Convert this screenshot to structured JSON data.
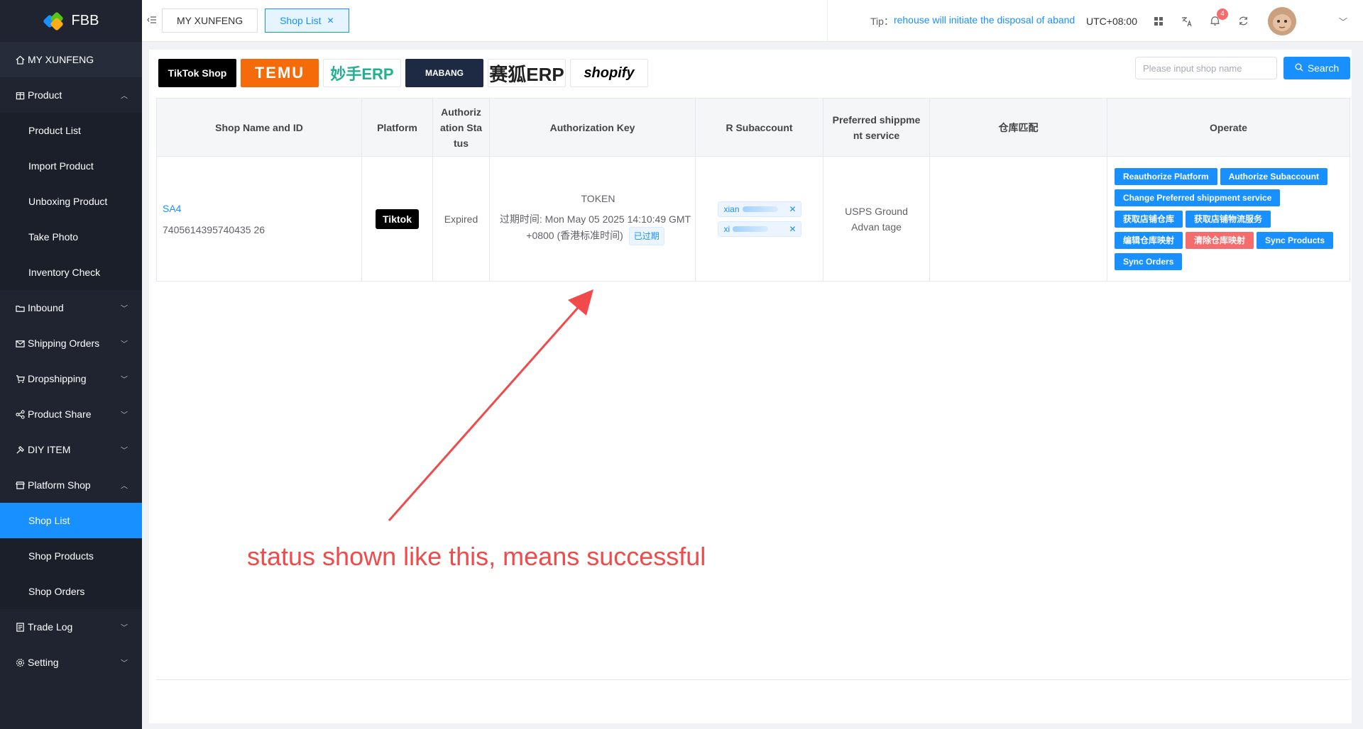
{
  "app": {
    "title": "FBB"
  },
  "sidebar": {
    "items": [
      {
        "label": "MY XUNFENG",
        "icon": "home-icon"
      },
      {
        "label": "Product",
        "icon": "box-icon",
        "expanded": true,
        "children": [
          "Product List",
          "Import Product",
          "Unboxing Product",
          "Take Photo",
          "Inventory Check"
        ]
      },
      {
        "label": "Inbound",
        "icon": "inbound-icon"
      },
      {
        "label": "Shipping Orders",
        "icon": "mail-icon"
      },
      {
        "label": "Dropshipping",
        "icon": "cart-icon"
      },
      {
        "label": "Product Share",
        "icon": "share-icon"
      },
      {
        "label": "DIY ITEM",
        "icon": "diy-icon"
      },
      {
        "label": "Platform Shop",
        "icon": "shop-icon",
        "expanded": true,
        "children": [
          "Shop List",
          "Shop Products",
          "Shop Orders"
        ],
        "active_child": "Shop List"
      },
      {
        "label": "Trade Log",
        "icon": "log-icon"
      },
      {
        "label": "Setting",
        "icon": "gear-icon"
      }
    ]
  },
  "header": {
    "tabs": [
      {
        "label": "MY XUNFENG",
        "active": false
      },
      {
        "label": "Shop List",
        "active": true,
        "closable": true
      }
    ],
    "tip_label": "Tip：",
    "tip_text": "rehouse will initiate the disposal of aband",
    "timezone": "UTC+08:00",
    "notification_count": "4"
  },
  "toolbar": {
    "platforms": [
      "TikTok Shop",
      "TEMU",
      "妙手ERP",
      "MABANG",
      "赛狐ERP",
      "shopify"
    ],
    "search_placeholder": "Please input shop name",
    "search_label": "Search"
  },
  "table": {
    "headers": [
      "Shop Name and ID",
      "Platform",
      "Authoriz ation Sta tus",
      "Authorization Key",
      "R Subaccount",
      "Preferred shippme nt service",
      "仓库匹配",
      "Operate"
    ],
    "rows": [
      {
        "shop_name": "SA4",
        "shop_id": "7405614395740435 26",
        "platform": "Tiktok",
        "status": "Expired",
        "token_label": "TOKEN",
        "token_expiry": "过期时间: Mon May 05 2025 14:10:49 GMT +0800 (香港标准时间)",
        "expired_tag": "已过期",
        "subaccounts": [
          "xian",
          "xi"
        ],
        "shipping_service": "USPS Ground Advan tage",
        "warehouse_match": "",
        "operations": [
          {
            "label": "Reauthorize Platform",
            "color": "#1890ff"
          },
          {
            "label": "Authorize Subaccount",
            "color": "#1890ff"
          },
          {
            "label": "Change Preferred shippment service",
            "color": "#1890ff"
          },
          {
            "label": "获取店铺仓库",
            "color": "#1890ff"
          },
          {
            "label": "获取店铺物流服务",
            "color": "#1890ff"
          },
          {
            "label": "编辑仓库映射",
            "color": "#1890ff"
          },
          {
            "label": "清除仓库映射",
            "color": "#f56c6c"
          },
          {
            "label": "Sync Products",
            "color": "#1890ff"
          },
          {
            "label": "Sync Orders",
            "color": "#1890ff"
          }
        ]
      }
    ]
  },
  "annotation": {
    "text": "status shown like this, means successful",
    "color": "#f04a4a"
  }
}
